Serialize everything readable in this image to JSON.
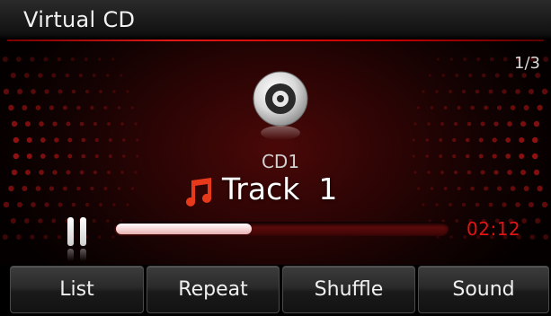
{
  "header": {
    "title": "Virtual CD",
    "page_indicator": "1/3"
  },
  "now_playing": {
    "disc_label": "CD1",
    "track_title": "Track  1",
    "elapsed_time": "02:12",
    "progress": 0.41,
    "state": "playing"
  },
  "icons": {
    "disc": "cd-icon",
    "track": "music-note-icon",
    "playback": "pause-icon"
  },
  "colors": {
    "accent": "#e31414",
    "note": "#e83a1a",
    "background": "#2a0404"
  },
  "softkeys": [
    {
      "label": "List"
    },
    {
      "label": "Repeat"
    },
    {
      "label": "Shuffle"
    },
    {
      "label": "Sound"
    }
  ]
}
